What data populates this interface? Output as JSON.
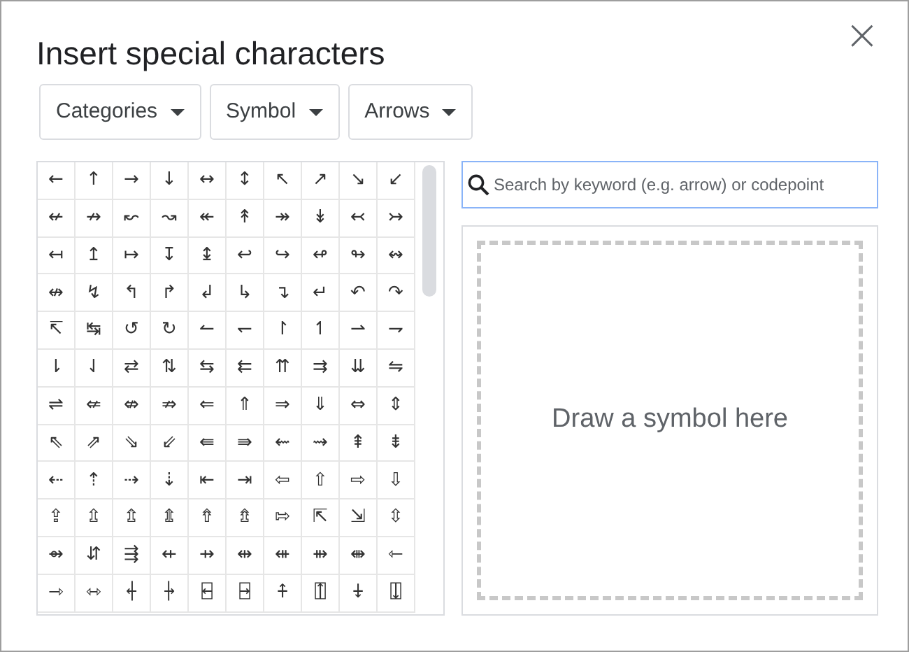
{
  "dialog": {
    "title": "Insert special characters",
    "close": "×"
  },
  "dropdowns": [
    {
      "label": "Categories"
    },
    {
      "label": "Symbol"
    },
    {
      "label": "Arrows"
    }
  ],
  "grid": [
    [
      "←",
      "↑",
      "→",
      "↓",
      "↔",
      "↕",
      "↖",
      "↗",
      "↘",
      "↙"
    ],
    [
      "↚",
      "↛",
      "↜",
      "↝",
      "↞",
      "↟",
      "↠",
      "↡",
      "↢",
      "↣"
    ],
    [
      "↤",
      "↥",
      "↦",
      "↧",
      "↨",
      "↩",
      "↪",
      "↫",
      "↬",
      "↭"
    ],
    [
      "↮",
      "↯",
      "↰",
      "↱",
      "↲",
      "↳",
      "↴",
      "↵",
      "↶",
      "↷"
    ],
    [
      "↸",
      "↹",
      "↺",
      "↻",
      "↼",
      "↽",
      "↾",
      "↿",
      "⇀",
      "⇁"
    ],
    [
      "⇂",
      "⇃",
      "⇄",
      "⇅",
      "⇆",
      "⇇",
      "⇈",
      "⇉",
      "⇊",
      "⇋"
    ],
    [
      "⇌",
      "⇍",
      "⇎",
      "⇏",
      "⇐",
      "⇑",
      "⇒",
      "⇓",
      "⇔",
      "⇕"
    ],
    [
      "⇖",
      "⇗",
      "⇘",
      "⇙",
      "⇚",
      "⇛",
      "⇜",
      "⇝",
      "⇞",
      "⇟"
    ],
    [
      "⇠",
      "⇡",
      "⇢",
      "⇣",
      "⇤",
      "⇥",
      "⇦",
      "⇧",
      "⇨",
      "⇩"
    ],
    [
      "⇪",
      "⇫",
      "⇬",
      "⇭",
      "⇮",
      "⇯",
      "⇰",
      "⇱",
      "⇲",
      "⇳"
    ],
    [
      "⇴",
      "⇵",
      "⇶",
      "⇷",
      "⇸",
      "⇹",
      "⇺",
      "⇻",
      "⇼",
      "⇽"
    ],
    [
      "⇾",
      "⇿",
      "⍅",
      "⍆",
      "⍇",
      "⍈",
      "⍏",
      "⍐",
      "⍖",
      "⍗"
    ]
  ],
  "search": {
    "placeholder": "Search by keyword (e.g. arrow) or codepoint"
  },
  "draw_area": {
    "hint": "Draw a symbol here"
  }
}
